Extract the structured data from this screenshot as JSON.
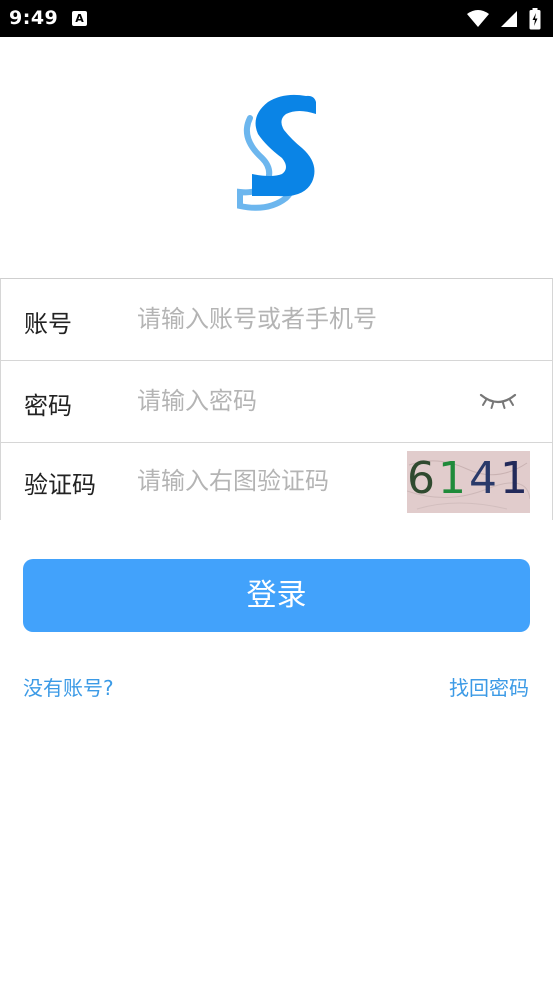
{
  "status_bar": {
    "time": "9:49",
    "notification_glyph": "A",
    "icons": [
      "wifi-icon",
      "signal-icon",
      "battery-icon"
    ]
  },
  "logo": {
    "icon": "app-logo-s-icon",
    "primary_color": "#0a84e6",
    "accent_color": "#6cb6ee"
  },
  "form": {
    "account": {
      "label": "账号",
      "placeholder": "请输入账号或者手机号",
      "value": ""
    },
    "password": {
      "label": "密码",
      "placeholder": "请输入密码",
      "value": "",
      "toggle_icon": "eye-closed-icon"
    },
    "captcha": {
      "label": "验证码",
      "placeholder": "请输入右图验证码",
      "value": "",
      "image_digits": [
        "6",
        "1",
        "4",
        "1"
      ]
    }
  },
  "actions": {
    "login_label": "登录",
    "register_link": "没有账号?",
    "recover_link": "找回密码"
  },
  "colors": {
    "primary": "#42a2fb",
    "link": "#3b9ae6",
    "divider": "#d6d6d6",
    "captcha_bg": "#e1cccc"
  }
}
